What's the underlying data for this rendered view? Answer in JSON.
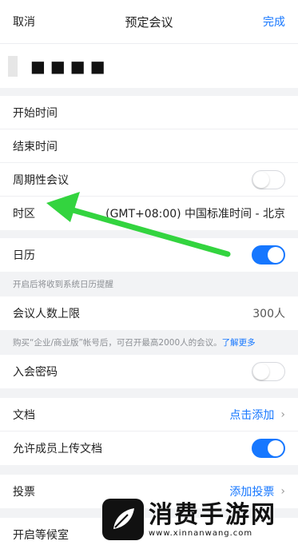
{
  "nav": {
    "cancel": "取消",
    "title": "预定会议",
    "done": "完成"
  },
  "topic": {
    "masked_text": "■■■■"
  },
  "rows": {
    "start_time": "开始时间",
    "end_time": "结束时间",
    "recurring": {
      "label": "周期性会议",
      "on": false
    },
    "timezone": {
      "label": "时区",
      "value": "(GMT+08:00) 中国标准时间 - 北京"
    },
    "calendar": {
      "label": "日历",
      "on": true
    },
    "calendar_hint": "开启后将收到系统日历提醒",
    "capacity": {
      "label": "会议人数上限",
      "value": "300人"
    },
    "capacity_hint": "购买“企业/商业版”帐号后，可召开最高2000人的会议。",
    "capacity_hint_link": "了解更多",
    "password": {
      "label": "入会密码",
      "on": false
    },
    "documents": {
      "label": "文档",
      "value": "点击添加"
    },
    "allow_upload": {
      "label": "允许成员上传文档",
      "on": true
    },
    "vote": {
      "label": "投票",
      "value": "添加投票"
    },
    "waiting_room": {
      "label": "开启等候室"
    }
  },
  "watermark": {
    "title": "消费手游网",
    "url": "www.xinnanwang.com"
  },
  "colors": {
    "accent": "#1677ff",
    "arrow": "#33d43f"
  }
}
